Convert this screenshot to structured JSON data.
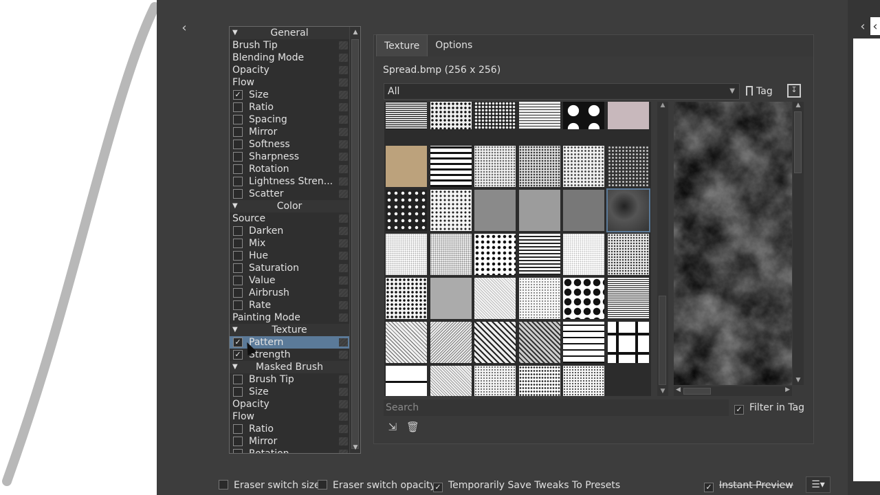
{
  "tree": {
    "rows": [
      {
        "kind": "cat",
        "label": "General"
      },
      {
        "kind": "plain",
        "label": "Brush Tip"
      },
      {
        "kind": "plain",
        "label": "Blending Mode"
      },
      {
        "kind": "plain",
        "label": "Opacity"
      },
      {
        "kind": "plain",
        "label": "Flow"
      },
      {
        "kind": "opt",
        "label": "Size",
        "checked": true
      },
      {
        "kind": "opt",
        "label": "Ratio",
        "checked": false
      },
      {
        "kind": "opt",
        "label": "Spacing",
        "checked": false
      },
      {
        "kind": "opt",
        "label": "Mirror",
        "checked": false
      },
      {
        "kind": "opt",
        "label": "Softness",
        "checked": false
      },
      {
        "kind": "opt",
        "label": "Sharpness",
        "checked": false
      },
      {
        "kind": "opt",
        "label": "Rotation",
        "checked": false
      },
      {
        "kind": "opt",
        "label": "Lightness Stren...",
        "checked": false
      },
      {
        "kind": "opt",
        "label": "Scatter",
        "checked": false
      },
      {
        "kind": "cat",
        "label": "Color"
      },
      {
        "kind": "plain",
        "label": "Source"
      },
      {
        "kind": "opt",
        "label": "Darken",
        "checked": false
      },
      {
        "kind": "opt",
        "label": "Mix",
        "checked": false
      },
      {
        "kind": "opt",
        "label": "Hue",
        "checked": false
      },
      {
        "kind": "opt",
        "label": "Saturation",
        "checked": false
      },
      {
        "kind": "opt",
        "label": "Value",
        "checked": false
      },
      {
        "kind": "opt",
        "label": "Airbrush",
        "checked": false
      },
      {
        "kind": "opt",
        "label": "Rate",
        "checked": false
      },
      {
        "kind": "plain",
        "label": "Painting Mode"
      },
      {
        "kind": "cat",
        "label": "Texture"
      },
      {
        "kind": "opt",
        "label": "Pattern",
        "checked": true,
        "selected": true
      },
      {
        "kind": "opt",
        "label": "Strength",
        "checked": true
      },
      {
        "kind": "cat",
        "label": "Masked Brush"
      },
      {
        "kind": "opt",
        "label": "Brush Tip",
        "checked": false
      },
      {
        "kind": "opt",
        "label": "Size",
        "checked": false
      },
      {
        "kind": "plain",
        "label": "Opacity"
      },
      {
        "kind": "plain",
        "label": "Flow"
      },
      {
        "kind": "opt",
        "label": "Ratio",
        "checked": false
      },
      {
        "kind": "opt",
        "label": "Mirror",
        "checked": false
      },
      {
        "kind": "opt",
        "label": "Rotation",
        "checked": false
      }
    ]
  },
  "tabs": {
    "texture": "Texture",
    "options": "Options"
  },
  "texture": {
    "file_label": "Spread.bmp (256 x 256)",
    "tag_filter": "All",
    "tag_button": "Tag",
    "search_placeholder": "Search",
    "filter_in_tag": "Filter in Tag"
  },
  "bottom": {
    "eraser_size": "Eraser switch size",
    "eraser_opacity": "Eraser switch opacity",
    "temp_save": "Temporarily Save Tweaks To Presets",
    "instant_preview": "Instant Preview"
  },
  "icons": {
    "collapse_left": "chevron-left-icon",
    "tag": "bookmark-icon",
    "import": "import-icon",
    "add_resource": "add-resource-icon",
    "delete": "trash-icon",
    "menu": "hamburger-menu-icon"
  },
  "colors": {
    "selection": "#5b7a99",
    "background": "#3d3d3d"
  }
}
